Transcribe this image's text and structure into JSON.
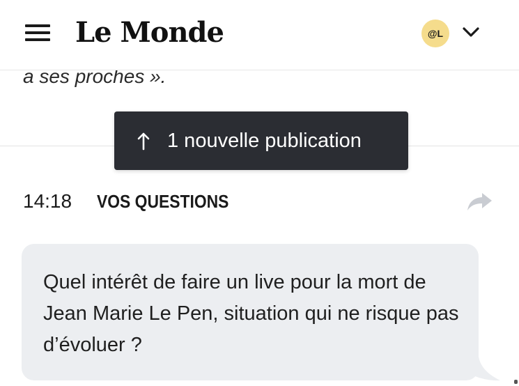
{
  "header": {
    "logo": "Le Monde",
    "avatar_initials": "@L"
  },
  "previous_post": {
    "text": "a ses proches »."
  },
  "new_publication": {
    "arrow": "↑",
    "label": "1 nouvelle publication"
  },
  "post": {
    "time": "14:18",
    "category": "VOS QUESTIONS",
    "question": "Quel intérêt de faire un live pour la mort de Jean Marie Le Pen, situation qui ne risque pas d’évoluer ?"
  },
  "icons": {
    "menu": "hamburger-menu-icon",
    "account": "chevron-down-icon",
    "share": "share-arrow-icon"
  },
  "colors": {
    "avatar_bg": "#f5dc8c",
    "toast_bg": "#2b2d33",
    "bubble_bg": "#eceef1",
    "share_icon": "#c9ccd2"
  }
}
